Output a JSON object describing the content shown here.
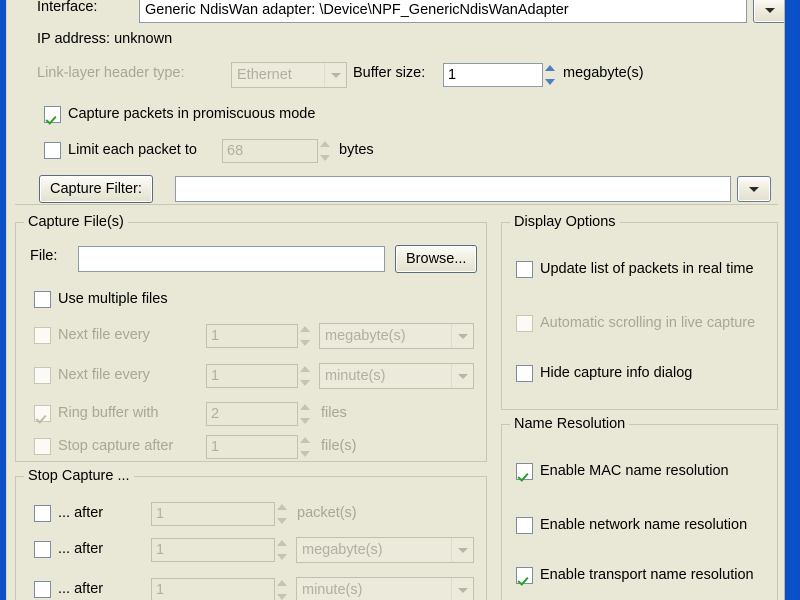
{
  "window": {
    "frame_color": "#0b4fc6",
    "client_bg": "#e9e7d6"
  },
  "top": {
    "interface_label": "Interface:",
    "interface_value": "Generic NdisWan adapter: \\Device\\NPF_GenericNdisWanAdapter",
    "interface_dropdown_icon": "chevron-down-icon",
    "ip_address_label": "IP address: unknown",
    "link_layer_label": "Link-layer header type:",
    "link_layer_value": "Ethernet",
    "buffer_size_label": "Buffer size:",
    "buffer_size_value": "1",
    "buffer_size_unit": "megabyte(s)",
    "promiscuous_label": "Capture packets in promiscuous mode",
    "promiscuous_checked": true,
    "limit_packet_label": "Limit each packet to",
    "limit_packet_value": "68",
    "limit_packet_unit": "bytes",
    "limit_packet_checked": false,
    "capture_filter_button": "Capture Filter:",
    "capture_filter_value": "",
    "capture_filter_dropdown_icon": "chevron-down-icon"
  },
  "capture_files": {
    "title": "Capture File(s)",
    "file_label": "File:",
    "file_value": "",
    "browse_button": "Browse...",
    "use_multiple_label": "Use multiple files",
    "use_multiple_checked": false,
    "rows": [
      {
        "label": "Next file every",
        "value": "1",
        "unit": "megabyte(s)",
        "unit_is_combo": true,
        "checked": false,
        "enabled": false
      },
      {
        "label": "Next file every",
        "value": "1",
        "unit": "minute(s)",
        "unit_is_combo": true,
        "checked": false,
        "enabled": false
      },
      {
        "label": "Ring buffer with",
        "value": "2",
        "unit": "files",
        "unit_is_combo": false,
        "checked": true,
        "enabled": false
      },
      {
        "label": "Stop capture after",
        "value": "1",
        "unit": "file(s)",
        "unit_is_combo": false,
        "checked": false,
        "enabled": false
      }
    ]
  },
  "stop_capture": {
    "title": "Stop Capture ...",
    "rows": [
      {
        "label": "... after",
        "value": "1",
        "unit": "packet(s)",
        "unit_is_combo": false,
        "checked": false,
        "enabled": false
      },
      {
        "label": "... after",
        "value": "1",
        "unit": "megabyte(s)",
        "unit_is_combo": true,
        "checked": false,
        "enabled": false
      },
      {
        "label": "... after",
        "value": "1",
        "unit": "minute(s)",
        "unit_is_combo": true,
        "checked": false,
        "enabled": false
      }
    ]
  },
  "display_options": {
    "title": "Display Options",
    "rows": [
      {
        "label": "Update list of packets in real time",
        "checked": false,
        "enabled": true
      },
      {
        "label": "Automatic scrolling in live capture",
        "checked": false,
        "enabled": false
      },
      {
        "label": "Hide capture info dialog",
        "checked": false,
        "enabled": true
      }
    ]
  },
  "name_resolution": {
    "title": "Name Resolution",
    "rows": [
      {
        "label": "Enable MAC name resolution",
        "checked": true,
        "enabled": true
      },
      {
        "label": "Enable network name resolution",
        "checked": false,
        "enabled": true
      },
      {
        "label": "Enable transport name resolution",
        "checked": true,
        "enabled": true
      }
    ]
  }
}
